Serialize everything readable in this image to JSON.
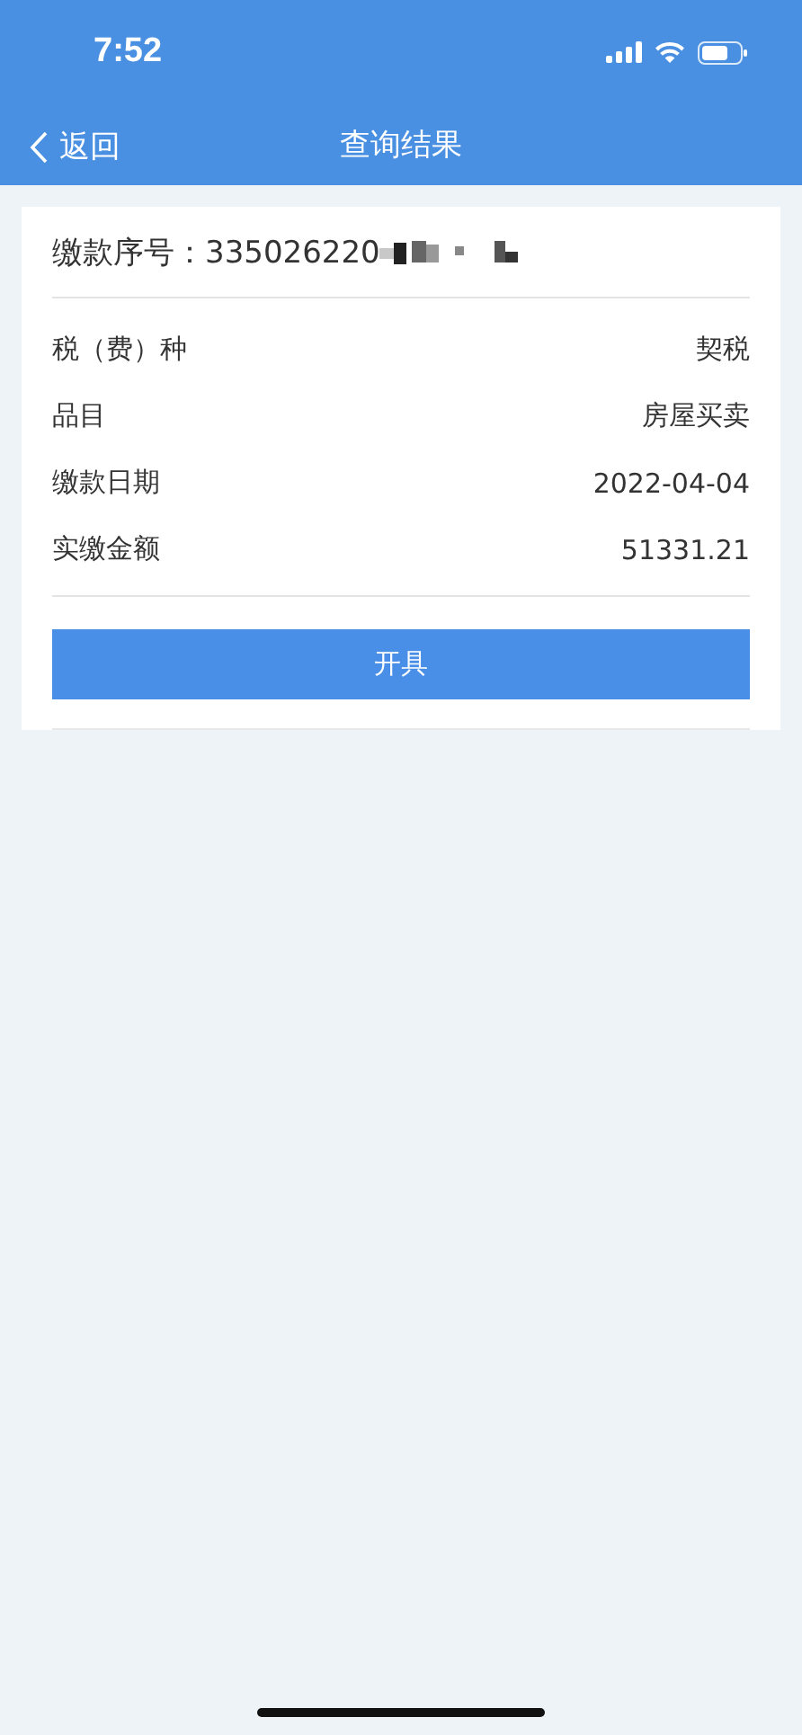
{
  "status_bar": {
    "time": "7:52"
  },
  "nav": {
    "back": "返回",
    "title": "查询结果"
  },
  "record": {
    "label": "缴款序号：",
    "number": "335026220",
    "number_redacted": true
  },
  "fields": [
    {
      "label": "税（费）种",
      "value": "契税"
    },
    {
      "label": "品目",
      "value": "房屋买卖"
    },
    {
      "label": "缴款日期",
      "value": "2022-04-04"
    },
    {
      "label": "实缴金额",
      "value": "51331.21"
    }
  ],
  "button": "开具"
}
